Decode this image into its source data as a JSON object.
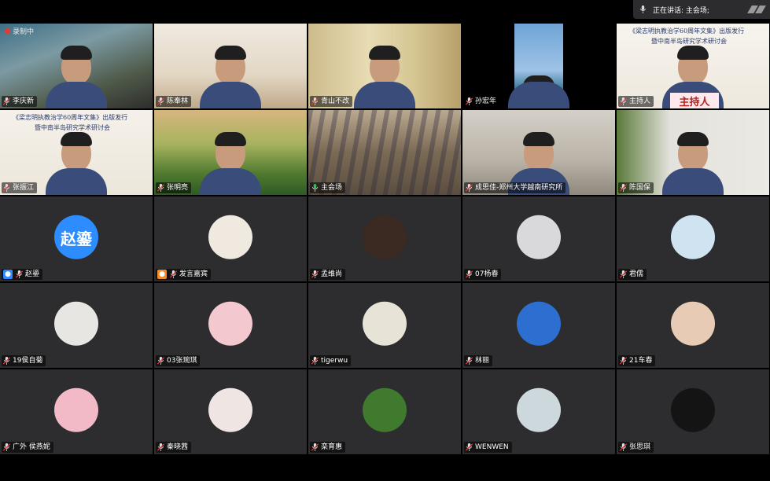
{
  "speaker_bar": {
    "label": "正在讲话: 主会场;"
  },
  "recording_label": "录制中",
  "tiles": [
    {
      "name": "李庆新",
      "kind": "video",
      "scene": "reef"
    },
    {
      "name": "陈奉林",
      "kind": "video",
      "scene": "office"
    },
    {
      "name": "青山不改",
      "kind": "video",
      "scene": "curtain"
    },
    {
      "name": "孙宏年",
      "kind": "video",
      "scene": "city"
    },
    {
      "name": "主持人",
      "kind": "video",
      "scene": "host",
      "banner": "《梁志明执教治学60周年文集》出版发行",
      "banner2": "暨中南半岛研究学术研讨会",
      "sign": "主持人"
    },
    {
      "name": "张振江",
      "kind": "video",
      "scene": "poster",
      "banner": "《梁志明执教治学60周年文集》出版发行",
      "banner2": "暨中南半岛研究学术研讨会"
    },
    {
      "name": "张明亮",
      "kind": "video",
      "scene": "hills"
    },
    {
      "name": "主会场",
      "kind": "video",
      "scene": "hall",
      "active": true
    },
    {
      "name": "成思佳-郑州大学越南研究所",
      "kind": "video",
      "scene": "bookshelf"
    },
    {
      "name": "陈国保",
      "kind": "video",
      "scene": "plant"
    },
    {
      "name": "赵鎏",
      "kind": "avatar",
      "avatar_text": "赵鎏",
      "user_icon": "blue"
    },
    {
      "name": "发言嘉宾",
      "kind": "avatar",
      "avatar_color": "#efe9df",
      "user_icon": "orange"
    },
    {
      "name": "孟维尚",
      "kind": "avatar",
      "avatar_color": "#3a2a22"
    },
    {
      "name": "07杨春",
      "kind": "avatar",
      "avatar_color": "#d9d9dc"
    },
    {
      "name": "君儒",
      "kind": "avatar",
      "avatar_color": "#cfe3f0"
    },
    {
      "name": "19侯自菊",
      "kind": "avatar",
      "avatar_color": "#e8e6e2"
    },
    {
      "name": "03张琬琪",
      "kind": "avatar",
      "avatar_color": "#f3c9cf"
    },
    {
      "name": "tigerwu",
      "kind": "avatar",
      "avatar_color": "#e7e3d6"
    },
    {
      "name": "林丽",
      "kind": "avatar",
      "avatar_color": "#2c6fd1"
    },
    {
      "name": "21车春",
      "kind": "avatar",
      "avatar_color": "#e8cbb4"
    },
    {
      "name": "广外 侯燕妮",
      "kind": "avatar",
      "avatar_color": "#f2b9c7"
    },
    {
      "name": "秦晓茜",
      "kind": "avatar",
      "avatar_color": "#efe6e4"
    },
    {
      "name": "栾育惠",
      "kind": "avatar",
      "avatar_color": "#3f7a2e"
    },
    {
      "name": "WENWEN",
      "kind": "avatar",
      "avatar_color": "#cdd8dc"
    },
    {
      "name": "张思琪",
      "kind": "avatar",
      "avatar_color": "#141414"
    }
  ]
}
